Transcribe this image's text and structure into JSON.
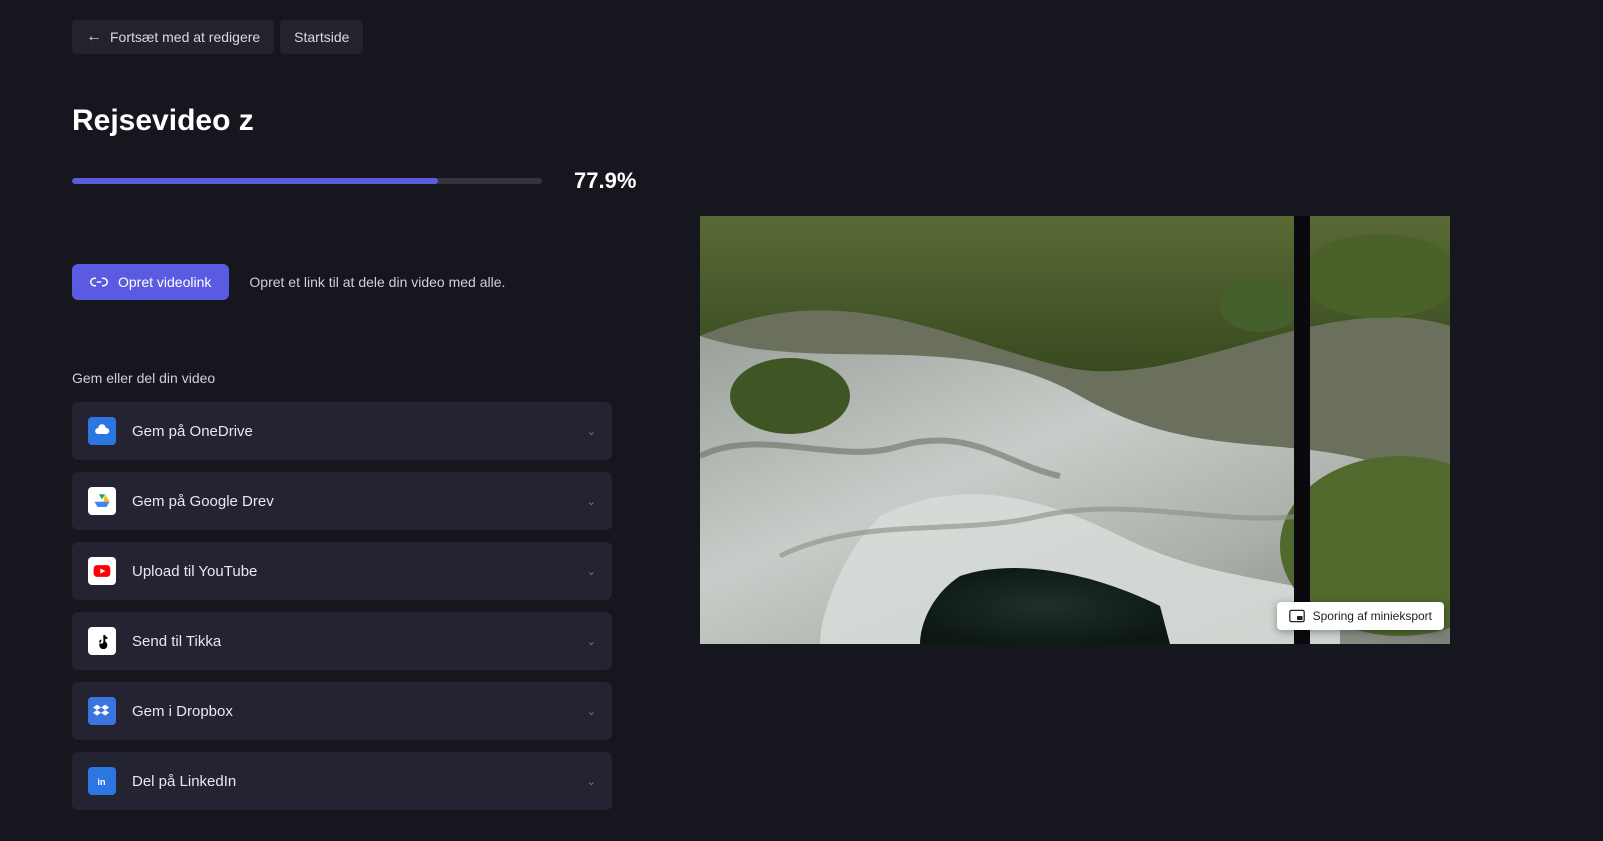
{
  "nav": {
    "continue_editing": "Fortsæt med at redigere",
    "home": "Startside"
  },
  "title": "Rejsevideo z",
  "progress": {
    "percent_label": "77.9%",
    "percent_value": 77.9
  },
  "videolink": {
    "button": "Opret videolink",
    "description": "Opret et link til at dele din video med alle."
  },
  "share": {
    "section_label": "Gem eller del din video",
    "items": [
      {
        "icon": "onedrive",
        "label": "Gem på OneDrive"
      },
      {
        "icon": "gdrive",
        "label": "Gem på Google Drev"
      },
      {
        "icon": "youtube",
        "label": "Upload til YouTube"
      },
      {
        "icon": "tiktok",
        "label": "Send til Tikka"
      },
      {
        "icon": "dropbox",
        "label": "Gem i Dropbox"
      },
      {
        "icon": "linkedin",
        "label": "Del på LinkedIn"
      }
    ]
  },
  "preview": {
    "pip_label": "Sporing af minieksport"
  }
}
